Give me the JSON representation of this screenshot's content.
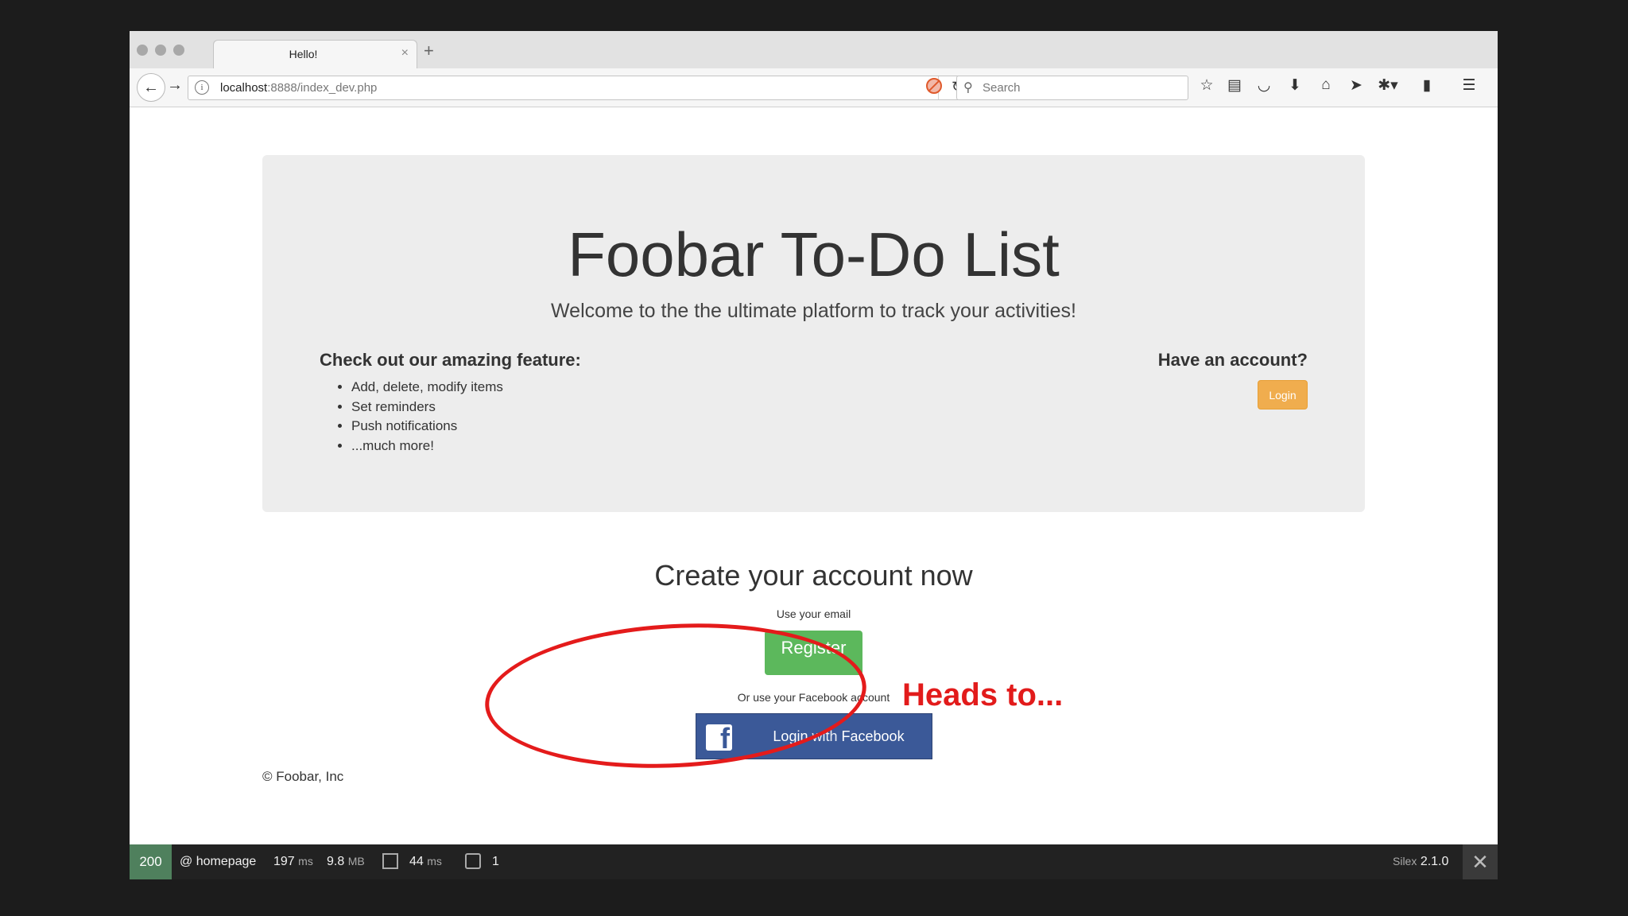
{
  "browser": {
    "tab_title": "Hello!",
    "tab_close": "×",
    "new_tab": "+",
    "url_host": "localhost",
    "url_path": ":8888/index_dev.php",
    "search_placeholder": "Search",
    "icons": [
      "back-icon",
      "forward-icon",
      "info-icon",
      "reload-icon",
      "blocked-icon",
      "search-icon",
      "star-icon",
      "reading-list-icon",
      "pocket-icon",
      "download-icon",
      "home-icon",
      "send-icon",
      "extension-icon",
      "book-icon",
      "menu-icon"
    ]
  },
  "hero": {
    "title": "Foobar To-Do List",
    "subtitle": "Welcome to the the ultimate platform to track your activities!",
    "features_heading": "Check out our amazing feature:",
    "features": [
      "Add, delete, modify items",
      "Set reminders",
      "Push notifications",
      "...much more!"
    ],
    "account_heading": "Have an account?",
    "login_label": "Login"
  },
  "signup": {
    "heading": "Create your account now",
    "email_label": "Use your email",
    "register_label": "Register",
    "facebook_label": "Or use your Facebook account",
    "fb_button_prefix": "Login",
    "fb_button_with": "with",
    "fb_button_suffix": "Facebook"
  },
  "footer": {
    "copyright": "© Foobar, Inc"
  },
  "annotation": {
    "text": "Heads to...",
    "color": "#e21b1b"
  },
  "debugbar": {
    "status": "200",
    "route": "@ homepage",
    "time": "197",
    "time_unit": "ms",
    "memory": "9.8",
    "memory_unit": "MB",
    "db_time": "44",
    "db_time_unit": "ms",
    "events": "1",
    "framework": "Silex",
    "version": "2.1.0",
    "close": "✕"
  },
  "colors": {
    "status_ok": "#4f805d",
    "login_button": "#f0ad4e",
    "register_button": "#5cb85c",
    "facebook_button": "#3b5998"
  }
}
